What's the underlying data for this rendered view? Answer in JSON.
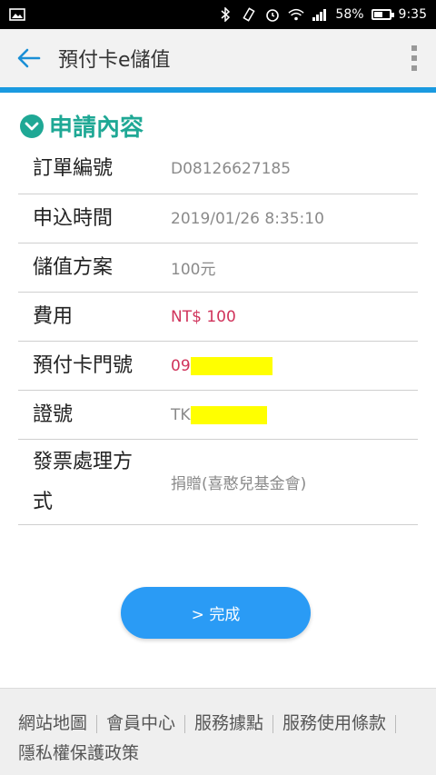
{
  "status_bar": {
    "battery": "58%",
    "battery_level": 0.58,
    "time": "9:35"
  },
  "app_bar": {
    "title": "預付卡e儲值"
  },
  "section": {
    "title": "申請內容"
  },
  "rows": [
    {
      "label": "訂單編號",
      "value": "D08126627185"
    },
    {
      "label": "申込時間",
      "value": "2019/01/26 8:35:10"
    },
    {
      "label": "儲值方案",
      "value": "100元"
    },
    {
      "label": "費用",
      "value": "NT$ 100"
    },
    {
      "label": "預付卡門號",
      "value": "09"
    },
    {
      "label": "證號",
      "value": "TK"
    },
    {
      "label": "發票處理方式",
      "value": "捐贈(喜憨兒基金會)"
    }
  ],
  "done_button": {
    "label": "> 完成"
  },
  "footer": {
    "links": [
      "網站地圖",
      "會員中心",
      "服務據點",
      "服務使用條款",
      "隱私權保護政策"
    ]
  },
  "colors": {
    "accent": "#1a9ae0",
    "section_title": "#1fa895",
    "fee": "#d0335b",
    "button": "#2a9bf5"
  }
}
